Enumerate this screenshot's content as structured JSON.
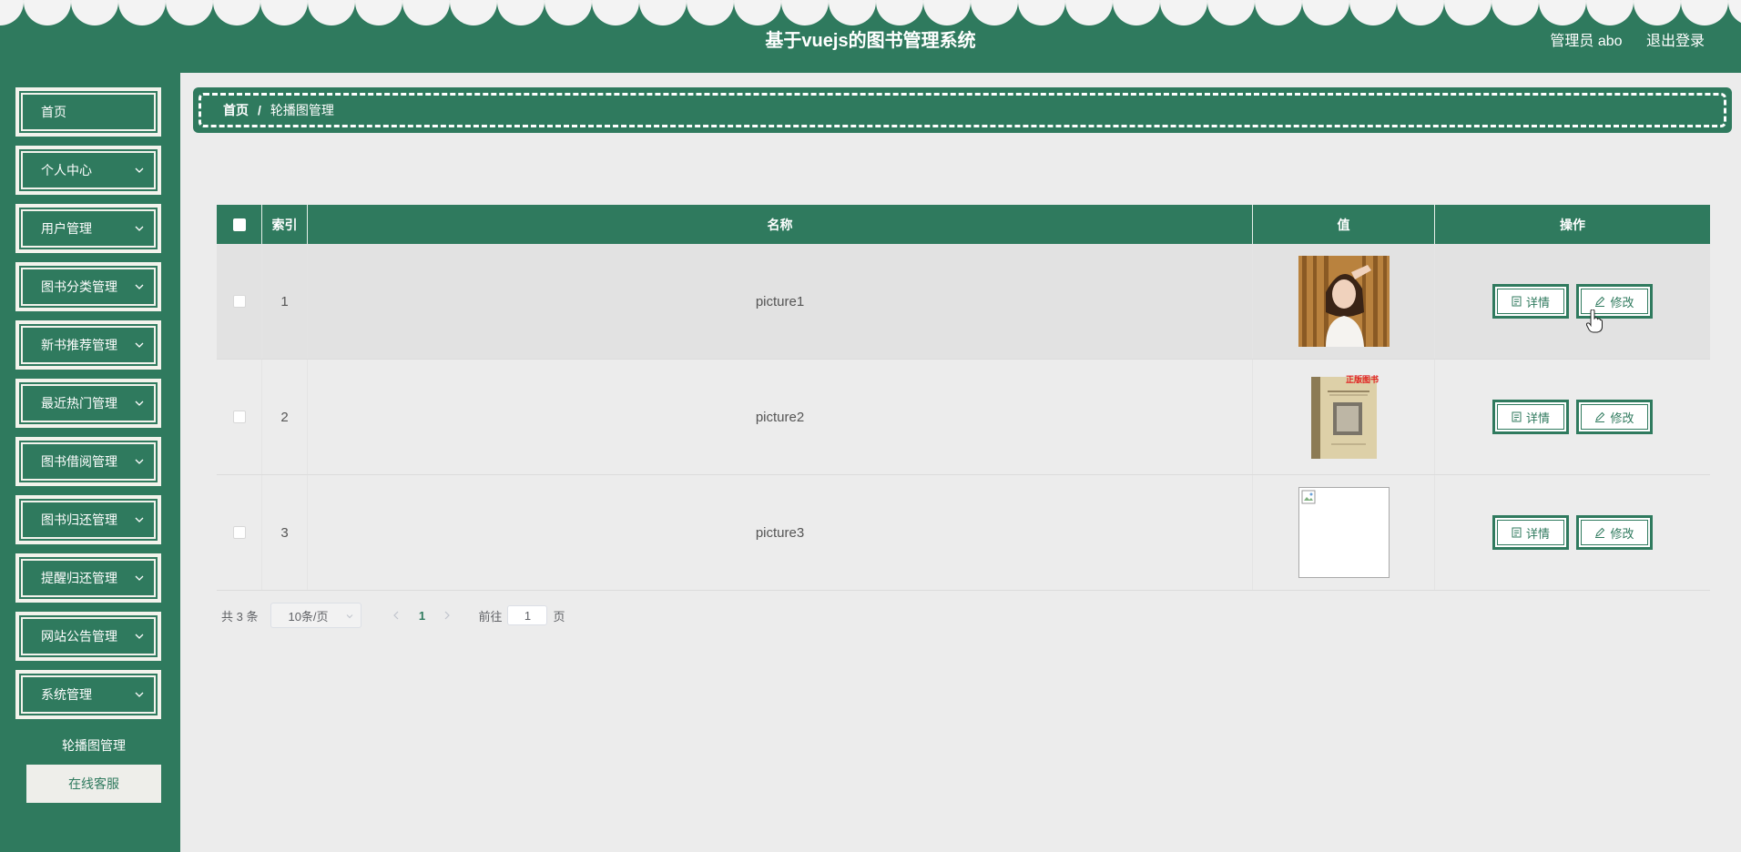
{
  "header": {
    "title": "基于vuejs的图书管理系统",
    "user_label": "管理员 abo",
    "logout_label": "退出登录"
  },
  "colors": {
    "primary": "#2f7a5e",
    "background": "#ececec",
    "accent_text": "#ffffff"
  },
  "sidebar": {
    "items": [
      {
        "label": "首页",
        "has_chevron": false
      },
      {
        "label": "个人中心",
        "has_chevron": true
      },
      {
        "label": "用户管理",
        "has_chevron": true
      },
      {
        "label": "图书分类管理",
        "has_chevron": true
      },
      {
        "label": "新书推荐管理",
        "has_chevron": true
      },
      {
        "label": "最近热门管理",
        "has_chevron": true
      },
      {
        "label": "图书借阅管理",
        "has_chevron": true
      },
      {
        "label": "图书归还管理",
        "has_chevron": true
      },
      {
        "label": "提醒归还管理",
        "has_chevron": true
      },
      {
        "label": "网站公告管理",
        "has_chevron": true
      },
      {
        "label": "系统管理",
        "has_chevron": true,
        "expanded": true
      }
    ],
    "submenu": [
      {
        "label": "轮播图管理",
        "active": true
      },
      {
        "label": "在线客服",
        "active": false
      }
    ]
  },
  "breadcrumb": {
    "home": "首页",
    "separator": "/",
    "current": "轮播图管理"
  },
  "table": {
    "columns": [
      "索引",
      "名称",
      "值",
      "操作"
    ],
    "rows": [
      {
        "index": "1",
        "name": "picture1",
        "image": "portrait-photo"
      },
      {
        "index": "2",
        "name": "picture2",
        "image": "book-cover",
        "book_badge": "正版图书"
      },
      {
        "index": "3",
        "name": "picture3",
        "image": "broken-image"
      }
    ],
    "detail_label": "详情",
    "edit_label": "修改"
  },
  "pagination": {
    "total": "共 3 条",
    "page_size": "10条/页",
    "current_page": "1",
    "goto_prefix": "前往",
    "goto_value": "1",
    "goto_suffix": "页"
  }
}
